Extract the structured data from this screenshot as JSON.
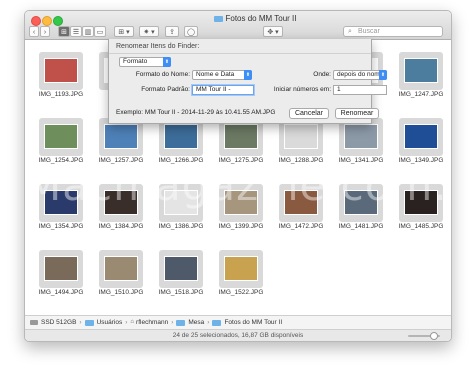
{
  "window": {
    "title": "Fotos do MM Tour II",
    "search_placeholder": "Buscar"
  },
  "toolbar": {
    "back": "‹",
    "forward": "›",
    "view_icon": "⊞",
    "view_list": "☰",
    "view_columns": "▥",
    "view_coverflow": "▭",
    "arrange": "⊞ ▾",
    "action": "✷ ▾",
    "share": "⇪",
    "tags": "◯",
    "dropbox": "✥ ▾"
  },
  "dialog": {
    "title": "Renomear Itens do Finder:",
    "mode_value": "Formato",
    "name_format_label": "Formato do Nome:",
    "name_format_value": "Nome e Data",
    "where_label": "Onde:",
    "where_value": "depois do nome",
    "custom_format_label": "Formato Padrão:",
    "custom_format_value": "MM Tour II - ",
    "start_numbers_label": "Iniciar números em:",
    "start_numbers_value": "1",
    "example": "Exemplo: MM Tour II - 2014-11-29 às 10.41.55 AM.JPG",
    "cancel_label": "Cancelar",
    "rename_label": "Renomear"
  },
  "files": [
    {
      "name": "IMG_1193.JPG",
      "color": "#c0504a"
    },
    {
      "name": "",
      "color": "#ffffff"
    },
    {
      "name": "",
      "color": "#ffffff"
    },
    {
      "name": "",
      "color": "#ffffff"
    },
    {
      "name": "",
      "color": "#ffffff"
    },
    {
      "name": "",
      "color": "#ffffff"
    },
    {
      "name": "IMG_1247.JPG",
      "color": "#4c7d9e"
    },
    {
      "name": "IMG_1254.JPG",
      "color": "#6e8e5c"
    },
    {
      "name": "IMG_1257.JPG",
      "color": "#4e81b8"
    },
    {
      "name": "IMG_1266.JPG",
      "color": "#3d6d9a"
    },
    {
      "name": "IMG_1275.JPG",
      "color": "#6c7a64"
    },
    {
      "name": "IMG_1288.JPG",
      "color": "#dadada"
    },
    {
      "name": "IMG_1341.JPG",
      "color": "#8c9aa8"
    },
    {
      "name": "IMG_1349.JPG",
      "color": "#1f4e96"
    },
    {
      "name": "IMG_1354.JPG",
      "color": "#2a3a6a"
    },
    {
      "name": "IMG_1384.JPG",
      "color": "#3a2e2a"
    },
    {
      "name": "IMG_1386.JPG",
      "color": "#e4e4e4"
    },
    {
      "name": "IMG_1399.JPG",
      "color": "#a6967e"
    },
    {
      "name": "IMG_1472.JPG",
      "color": "#8a5a40"
    },
    {
      "name": "IMG_1481.JPG",
      "color": "#5a6a7a"
    },
    {
      "name": "IMG_1485.JPG",
      "color": "#2a2220"
    },
    {
      "name": "IMG_1494.JPG",
      "color": "#7a6a5a"
    },
    {
      "name": "IMG_1510.JPG",
      "color": "#9a8a72"
    },
    {
      "name": "IMG_1518.JPG",
      "color": "#4e5a6a"
    },
    {
      "name": "IMG_1522.JPG",
      "color": "#c8a24e"
    }
  ],
  "watermark": "Macmagazine.com.br",
  "pathbar": {
    "items": [
      "SSD 512GB",
      "Usuários",
      "rflechmann",
      "Mesa",
      "Fotos do MM Tour II"
    ],
    "separator": "›"
  },
  "status": "24 de 25 selecionados, 16,87 GB disponíveis"
}
